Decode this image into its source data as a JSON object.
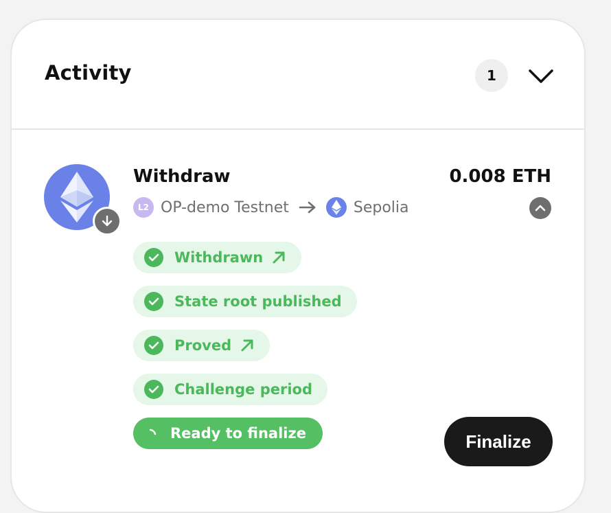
{
  "activity": {
    "title": "Activity",
    "count": "1"
  },
  "transaction": {
    "type": "Withdraw",
    "amount": "0.008 ETH",
    "token_icon": "ethereum-icon",
    "direction_icon": "arrow-down-icon",
    "from_chain": {
      "name": "OP-demo Testnet",
      "badge": "L2"
    },
    "to_chain": {
      "name": "Sepolia",
      "icon": "ethereum-icon"
    },
    "steps": [
      {
        "label": "Withdrawn",
        "status": "complete",
        "has_link": true
      },
      {
        "label": "State root published",
        "status": "complete",
        "has_link": false
      },
      {
        "label": "Proved",
        "status": "complete",
        "has_link": true
      },
      {
        "label": "Challenge period",
        "status": "complete",
        "has_link": false
      },
      {
        "label": "Ready to finalize",
        "status": "in-progress",
        "has_link": false
      }
    ],
    "action_label": "Finalize"
  },
  "colors": {
    "success": "#4cb85c",
    "success_bg": "#e5f7e8",
    "eth": "#6a82e8",
    "button_dark": "#1a1a1a"
  }
}
